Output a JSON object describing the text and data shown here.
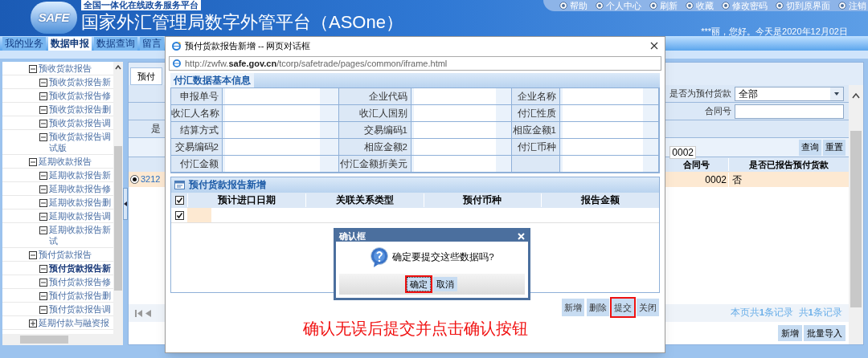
{
  "header": {
    "platform_tag": "全国一体化在线政务服务平台",
    "logo_text": "SAFE",
    "title": "国家外汇管理局数字外管平台（ASOne）",
    "links": [
      "帮助",
      "个人中心",
      "刷新",
      "收藏",
      "修改密码",
      "切到原界面",
      "注销"
    ],
    "greeting": "***丽，您好。今天是2020年12月02日"
  },
  "nav_tabs": [
    {
      "label": "我的业务",
      "selected": false
    },
    {
      "label": "数据申报",
      "selected": true
    },
    {
      "label": "数据查询",
      "selected": false
    },
    {
      "label": "留言",
      "selected": false
    }
  ],
  "sidebar": {
    "items": [
      {
        "label": "预收货款报告",
        "expanded": true,
        "selected": false,
        "children": [
          {
            "label": "预收货款报告新",
            "expanded": true,
            "selected": false
          },
          {
            "label": "预收货款报告修",
            "expanded": true,
            "selected": false
          },
          {
            "label": "预收货款报告删",
            "expanded": true,
            "selected": false
          },
          {
            "label": "预收货款报告调",
            "expanded": true,
            "selected": false
          },
          {
            "label": "预收货款报告调试版",
            "expanded": true,
            "selected": false
          }
        ]
      },
      {
        "label": "延期收款报告",
        "expanded": true,
        "selected": false,
        "children": [
          {
            "label": "延期收款报告新",
            "expanded": true,
            "selected": false
          },
          {
            "label": "延期收款报告修",
            "expanded": true,
            "selected": false
          },
          {
            "label": "延期收款报告删",
            "expanded": true,
            "selected": false
          },
          {
            "label": "延期收款报告调",
            "expanded": true,
            "selected": false
          },
          {
            "label": "延期收款报告新试",
            "expanded": true,
            "selected": false
          }
        ]
      },
      {
        "label": "预付货款报告",
        "expanded": true,
        "selected": false,
        "children": [
          {
            "label": "预付货款报告新",
            "expanded": true,
            "selected": true
          },
          {
            "label": "预付货款报告修",
            "expanded": true,
            "selected": false
          },
          {
            "label": "预付货款报告删",
            "expanded": true,
            "selected": false
          },
          {
            "label": "预付货款报告调",
            "expanded": true,
            "selected": false
          }
        ]
      },
      {
        "label": "延期付款与融资报",
        "expanded": false,
        "selected": false
      }
    ]
  },
  "main": {
    "tab": "预付",
    "filters": [
      {
        "kind": "select",
        "label": "是否为预付货款",
        "value": "全部"
      },
      {
        "kind": "input",
        "label": "合同号"
      }
    ],
    "left_label": "是",
    "buttons": [
      "查询",
      "重置"
    ],
    "tooltip": "0002",
    "table": {
      "columns": [
        "合同号",
        "是否已报告预付货款"
      ],
      "rows": [
        {
          "id": "3212",
          "contract": "0002",
          "reported": "否",
          "selected": true
        }
      ]
    },
    "pager": "本页共**1**条记录  共**1**条记录",
    "actions": [
      "新增",
      "批量导入"
    ]
  },
  "dialog": {
    "title": "预付货款报告新增 -- 网页对话框",
    "url": "http://zwfw.**safe.gov.cn**/tcorp/safetrade/pages/common/iframe.html",
    "info": {
      "title": "付汇数据基本信息",
      "rows": [
        [
          "申报单号",
          "企业代码",
          "企业名称"
        ],
        [
          "收汇人名称",
          "收汇人国别",
          "付汇性质"
        ],
        [
          "结算方式",
          "交易编码1",
          "相应金额1"
        ],
        [
          "交易编码2",
          "相应金额2",
          "付汇币种"
        ],
        [
          "付汇金额",
          "付汇金额折美元"
        ]
      ]
    },
    "grid": {
      "title": "预付货款报告新增",
      "all_checked": true,
      "columns": [
        "预计进口日期",
        "关联关系类型",
        "预付币种",
        "报告金额"
      ],
      "rows": [
        {
          "checked": true
        }
      ]
    },
    "buttons": [
      {
        "label": "新增",
        "highlighted": false
      },
      {
        "label": "删除",
        "highlighted": false
      },
      {
        "label": "提交",
        "highlighted": true
      },
      {
        "label": "关闭",
        "highlighted": false
      }
    ],
    "instruction": "确认无误后提交并点击确认按钮"
  },
  "confirm": {
    "title": "确认框",
    "message": "确定要提交这些数据吗?",
    "buttons": [
      {
        "label": "确定",
        "highlighted": true,
        "focused": true
      },
      {
        "label": "取消",
        "highlighted": false,
        "focused": false
      }
    ]
  }
}
